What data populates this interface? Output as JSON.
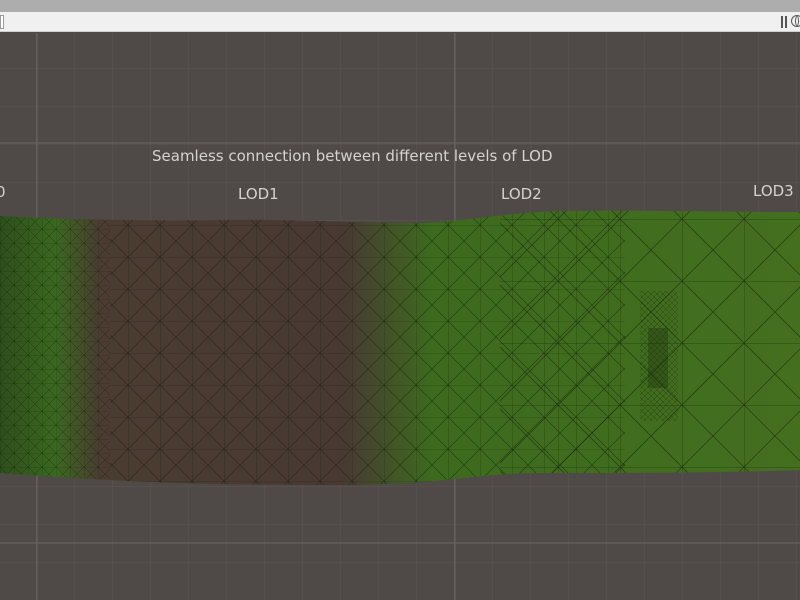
{
  "scene": {
    "title": "Seamless connection between different levels of LOD",
    "lod_labels": [
      {
        "text": "0"
      },
      {
        "text": "LOD1"
      },
      {
        "text": "LOD2"
      },
      {
        "text": "LOD3"
      }
    ]
  },
  "toolbar": {
    "icons": [
      "pause-icon",
      "globe-icon"
    ]
  },
  "colors": {
    "background": "#4f4a47",
    "grid_line": "#5e5955",
    "grass": "#3f6e1e",
    "dirt": "#483a33",
    "wireframe": "#101a08"
  }
}
